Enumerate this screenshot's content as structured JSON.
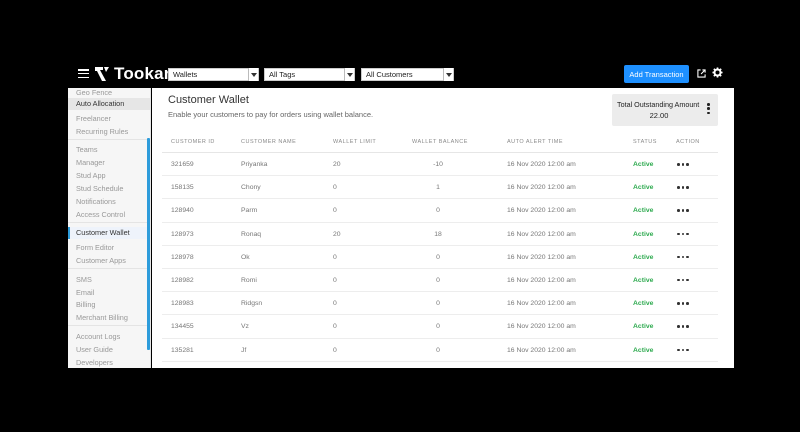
{
  "header": {
    "brand": "Tookan",
    "filters": [
      {
        "value": "Wallets"
      },
      {
        "value": "All Tags"
      },
      {
        "value": "All Customers"
      }
    ],
    "add_button": "Add Transaction"
  },
  "sidebar": {
    "items": [
      {
        "label": "Geo Fence"
      },
      {
        "label": "Auto Allocation"
      },
      {
        "label": "Freelancer"
      },
      {
        "label": "Recurring Rules"
      },
      {
        "label": "Teams"
      },
      {
        "label": "Manager"
      },
      {
        "label": "Stud App"
      },
      {
        "label": "Stud Schedule"
      },
      {
        "label": "Notifications"
      },
      {
        "label": "Access Control"
      },
      {
        "label": "Customer Wallet"
      },
      {
        "label": "Form Editor"
      },
      {
        "label": "Customer Apps"
      },
      {
        "label": "SMS"
      },
      {
        "label": "Email"
      },
      {
        "label": "Billing"
      },
      {
        "label": "Merchant Billing"
      },
      {
        "label": "Account Logs"
      },
      {
        "label": "User Guide"
      },
      {
        "label": "Developers"
      }
    ]
  },
  "page": {
    "title": "Customer Wallet",
    "subtitle": "Enable your customers to pay for orders using wallet balance.",
    "outstanding_label": "Total Outstanding Amount",
    "outstanding_value": "22.00"
  },
  "table": {
    "columns": [
      "Customer ID",
      "Customer Name",
      "Wallet Limit",
      "Wallet Balance",
      "Auto Alert Time",
      "Status",
      "Action"
    ],
    "rows": [
      {
        "id": "321659",
        "name": "Priyanka",
        "limit": "20",
        "balance": "-10",
        "alert": "16 Nov 2020 12:00 am",
        "status": "Active"
      },
      {
        "id": "158135",
        "name": "Chony",
        "limit": "0",
        "balance": "1",
        "alert": "16 Nov 2020 12:00 am",
        "status": "Active"
      },
      {
        "id": "128940",
        "name": "Parm",
        "limit": "0",
        "balance": "0",
        "alert": "16 Nov 2020 12:00 am",
        "status": "Active"
      },
      {
        "id": "128973",
        "name": "Ronaq",
        "limit": "20",
        "balance": "18",
        "alert": "16 Nov 2020 12:00 am",
        "status": "Active"
      },
      {
        "id": "128978",
        "name": "Ok",
        "limit": "0",
        "balance": "0",
        "alert": "16 Nov 2020 12:00 am",
        "status": "Active"
      },
      {
        "id": "128982",
        "name": "Romi",
        "limit": "0",
        "balance": "0",
        "alert": "16 Nov 2020 12:00 am",
        "status": "Active"
      },
      {
        "id": "128983",
        "name": "Ridgsn",
        "limit": "0",
        "balance": "0",
        "alert": "16 Nov 2020 12:00 am",
        "status": "Active"
      },
      {
        "id": "134455",
        "name": "Vz",
        "limit": "0",
        "balance": "0",
        "alert": "16 Nov 2020 12:00 am",
        "status": "Active"
      },
      {
        "id": "135281",
        "name": "Jf",
        "limit": "0",
        "balance": "0",
        "alert": "16 Nov 2020 12:00 am",
        "status": "Active"
      }
    ]
  },
  "colors": {
    "accent": "#1e90ff",
    "active": "#2eaa4f",
    "sidebar_indicator": "#2d9cdb"
  }
}
